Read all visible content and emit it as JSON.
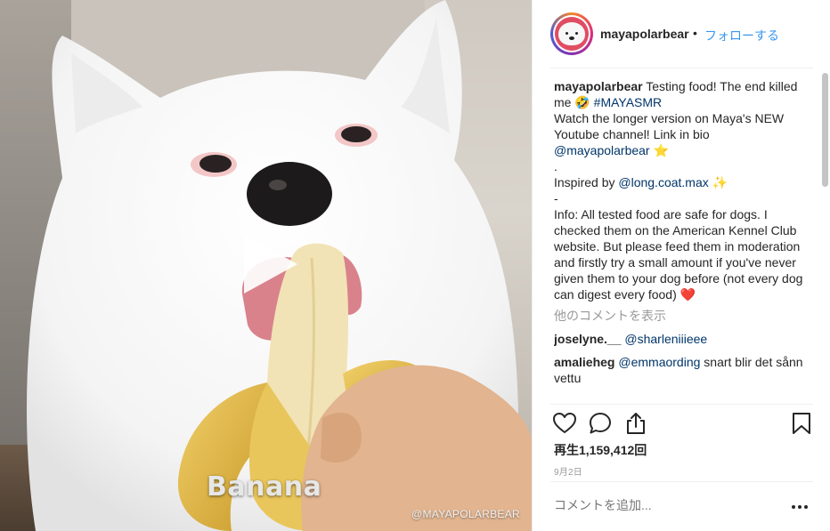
{
  "media": {
    "caption_overlay": "Banana",
    "watermark": "@MAYAPOLARBEAR"
  },
  "header": {
    "username": "mayapolarbear",
    "separator": "•",
    "follow_label": "フォローする"
  },
  "caption": {
    "username": "mayapolarbear",
    "text_1": "Testing food! The end killed me",
    "emoji_1": "🤣",
    "hashtag": "#MAYASMR",
    "line_2": "Watch the longer version on Maya's NEW Youtube channel! Link in bio",
    "mention_1": "@mayapolarbear",
    "emoji_2": "⭐",
    "dot_line": ".",
    "inspired_prefix": "Inspired by",
    "mention_2": "@long.coat.max",
    "emoji_3": "✨",
    "dash_line": "-",
    "info_text": "Info: All tested food are safe for dogs. I checked them on the American Kennel Club website. But please feed them in moderation and firstly try a small amount if you've never given them to your dog before (not every dog can digest every food)",
    "emoji_4": "❤️"
  },
  "view_comments_label": "他のコメントを表示",
  "comments": [
    {
      "username": "joselyne.__",
      "mention": "@sharleniiieee",
      "text": ""
    },
    {
      "username": "amalieheg",
      "mention": "@emmaording",
      "text": "snart blir det sånn vettu"
    }
  ],
  "stats": {
    "views": "再生1,159,412回",
    "date": "9月2日"
  },
  "comment_box": {
    "placeholder": "コメントを追加..."
  },
  "icons": {
    "like": "heart-icon",
    "comment": "comment-bubble-icon",
    "share": "share-upload-icon",
    "bookmark": "bookmark-icon",
    "more": "more-dots-icon",
    "play": "play-icon"
  },
  "colors": {
    "link": "#003569",
    "follow": "#3897f0",
    "muted": "#999999",
    "text": "#262626"
  }
}
